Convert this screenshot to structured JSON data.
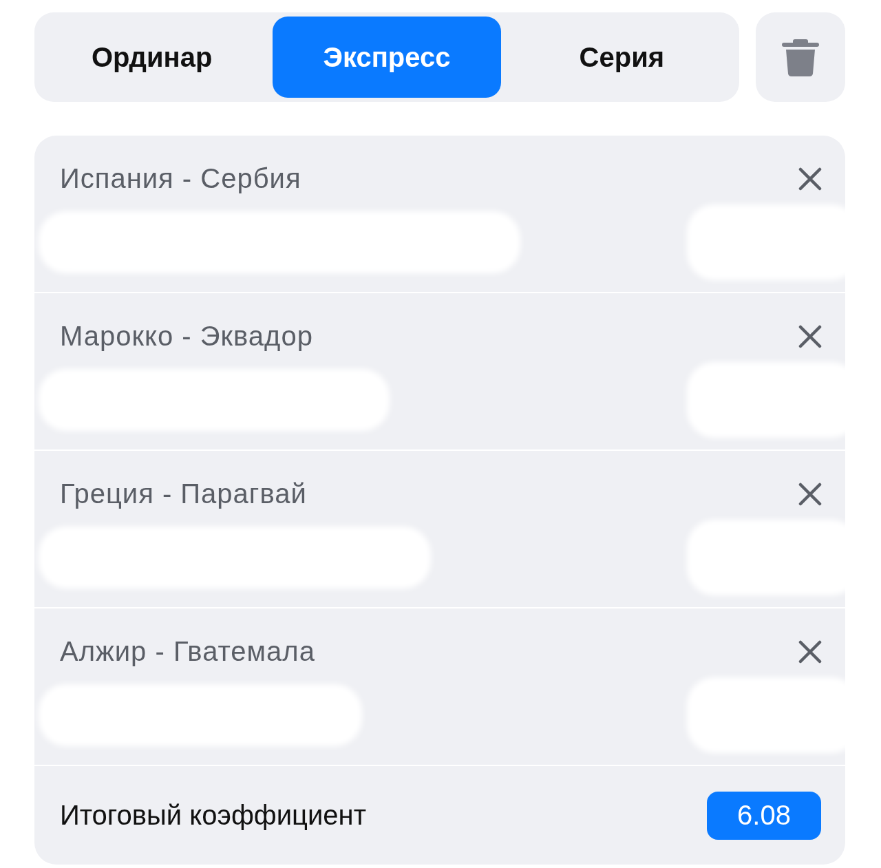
{
  "tabs": [
    {
      "label": "Ординар",
      "selected": false
    },
    {
      "label": "Экспресс",
      "selected": true
    },
    {
      "label": "Серия",
      "selected": false
    }
  ],
  "bets": [
    {
      "match": "Испания - Сербия",
      "redacted": true
    },
    {
      "match": "Марокко - Эквадор",
      "redacted": true
    },
    {
      "match": "Греция - Парагвай",
      "redacted": true
    },
    {
      "match": "Алжир - Гватемала",
      "redacted": true
    }
  ],
  "total": {
    "label": "Итоговый коэффициент",
    "value": "6.08"
  }
}
